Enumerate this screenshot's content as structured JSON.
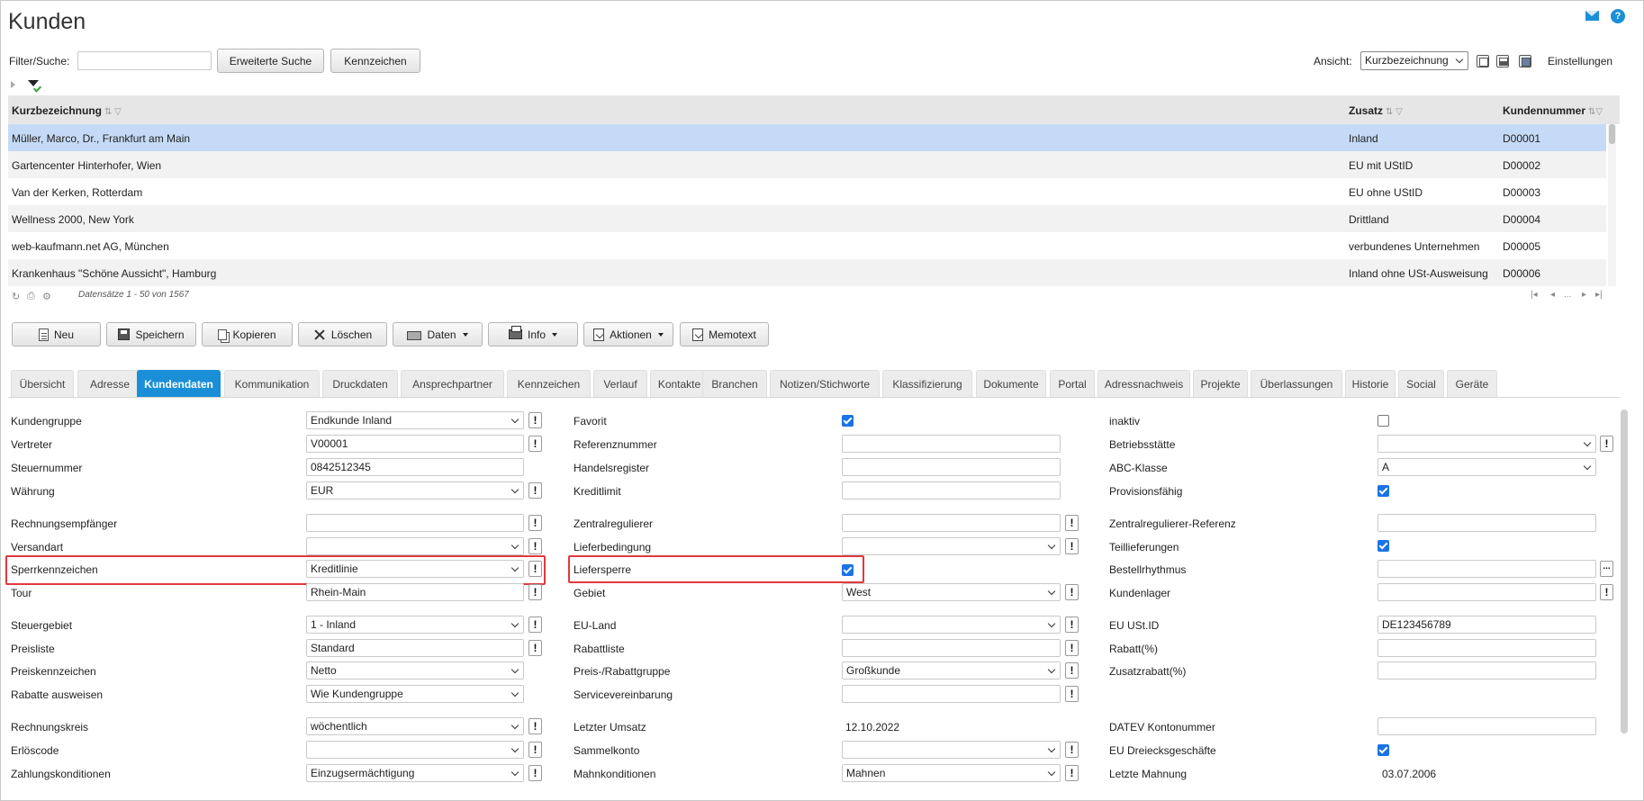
{
  "page": {
    "title": "Kunden"
  },
  "toolbar": {
    "filter_label": "Filter/Suche:",
    "filter_value": "",
    "extended_search": "Erweiterte Suche",
    "marks": "Kennzeichen",
    "view_label": "Ansicht:",
    "view_value": "Kurzbezeichnung",
    "settings": "Einstellungen"
  },
  "grid": {
    "columns": [
      "Kurzbezeichnung",
      "Zusatz",
      "Kundennummer"
    ],
    "rows": [
      [
        "Müller, Marco, Dr., Frankfurt am Main",
        "Inland",
        "D00001"
      ],
      [
        "Gartencenter Hinterhofer, Wien",
        "EU mit UStID",
        "D00002"
      ],
      [
        "Van der Kerken, Rotterdam",
        "EU ohne UStID",
        "D00003"
      ],
      [
        "Wellness 2000, New York",
        "Drittland",
        "D00004"
      ],
      [
        "web-kaufmann.net AG, München",
        "verbundenes Unternehmen",
        "D00005"
      ],
      [
        "Krankenhaus \"Schöne Aussicht\", Hamburg",
        "Inland ohne USt-Ausweisung",
        "D00006"
      ]
    ],
    "record_info": "Datensätze 1 - 50 von 1567",
    "pager_ellipsis": "..."
  },
  "actions": {
    "new": "Neu",
    "save": "Speichern",
    "copy": "Kopieren",
    "delete": "Löschen",
    "data": "Daten",
    "info": "Info",
    "actions": "Aktionen",
    "memo": "Memotext"
  },
  "tabs": [
    "Übersicht",
    "Adresse",
    "Kundendaten",
    "Kommunikation",
    "Druckdaten",
    "Ansprechpartner",
    "Kennzeichen",
    "Verlauf",
    "Kontakte",
    "Branchen",
    "Notizen/Stichworte",
    "Klassifizierung",
    "Dokumente",
    "Portal",
    "Adressnachweis",
    "Projekte",
    "Überlassungen",
    "Historie",
    "Social",
    "Geräte"
  ],
  "active_tab": "Kundendaten",
  "form": {
    "col1": {
      "kundengruppe": {
        "label": "Kundengruppe",
        "value": "Endkunde Inland"
      },
      "vertreter": {
        "label": "Vertreter",
        "value": "V00001"
      },
      "steuernummer": {
        "label": "Steuernummer",
        "value": "0842512345"
      },
      "waehrung": {
        "label": "Währung",
        "value": "EUR"
      },
      "rechnungsempfaenger": {
        "label": "Rechnungsempfänger",
        "value": ""
      },
      "versandart": {
        "label": "Versandart",
        "value": ""
      },
      "sperrkennzeichen": {
        "label": "Sperrkennzeichen",
        "value": "Kreditlinie"
      },
      "tour": {
        "label": "Tour",
        "value": "Rhein-Main"
      },
      "steuergebiet": {
        "label": "Steuergebiet",
        "value": "1 - Inland"
      },
      "preisliste": {
        "label": "Preisliste",
        "value": "Standard"
      },
      "preiskennzeichen": {
        "label": "Preiskennzeichen",
        "value": "Netto"
      },
      "rabatte": {
        "label": "Rabatte ausweisen",
        "value": "Wie Kundengruppe"
      },
      "rechnungskreis": {
        "label": "Rechnungskreis",
        "value": "wöchentlich"
      },
      "erloescode": {
        "label": "Erlöscode",
        "value": ""
      },
      "zahlungskonditionen": {
        "label": "Zahlungskonditionen",
        "value": "Einzugsermächtigung"
      }
    },
    "col2": {
      "favorit": {
        "label": "Favorit",
        "checked": true
      },
      "referenznummer": {
        "label": "Referenznummer",
        "value": ""
      },
      "handelsregister": {
        "label": "Handelsregister",
        "value": ""
      },
      "kreditlimit": {
        "label": "Kreditlimit",
        "value": ""
      },
      "zentralregulierer": {
        "label": "Zentralregulierer",
        "value": ""
      },
      "lieferbedingung": {
        "label": "Lieferbedingung",
        "value": ""
      },
      "liefersperre": {
        "label": "Liefersperre",
        "checked": true
      },
      "gebiet": {
        "label": "Gebiet",
        "value": "West"
      },
      "eu_land": {
        "label": "EU-Land",
        "value": ""
      },
      "rabattliste": {
        "label": "Rabattliste",
        "value": ""
      },
      "preis_rabattgruppe": {
        "label": "Preis-/Rabattgruppe",
        "value": "Großkunde"
      },
      "servicevereinbarung": {
        "label": "Servicevereinbarung",
        "value": ""
      },
      "letzter_umsatz": {
        "label": "Letzter Umsatz",
        "value": "12.10.2022"
      },
      "sammelkonto": {
        "label": "Sammelkonto",
        "value": ""
      },
      "mahnkonditionen": {
        "label": "Mahnkonditionen",
        "value": "Mahnen"
      }
    },
    "col3": {
      "inaktiv": {
        "label": "inaktiv",
        "checked": false
      },
      "betriebsstaette": {
        "label": "Betriebsstätte",
        "value": ""
      },
      "abc_klasse": {
        "label": "ABC-Klasse",
        "value": "A"
      },
      "provisionsfaehig": {
        "label": "Provisionsfähig",
        "checked": true
      },
      "zentralregulierer_ref": {
        "label": "Zentralregulierer-Referenz",
        "value": ""
      },
      "teillieferungen": {
        "label": "Teillieferungen",
        "checked": true
      },
      "bestellrhythmus": {
        "label": "Bestellrhythmus",
        "value": ""
      },
      "kundenlager": {
        "label": "Kundenlager",
        "value": ""
      },
      "eu_ustid": {
        "label": "EU USt.ID",
        "value": "DE123456789"
      },
      "rabatt": {
        "label": "Rabatt(%)",
        "value": ""
      },
      "zusatzrabatt": {
        "label": "Zusatzrabatt(%)",
        "value": ""
      },
      "datev": {
        "label": "DATEV Kontonummer",
        "value": ""
      },
      "eu_dreieck": {
        "label": "EU Dreiecksgeschäfte",
        "checked": true
      },
      "letzte_mahnung": {
        "label": "Letzte Mahnung",
        "value": "03.07.2006"
      }
    }
  },
  "icons": [
    "mail-icon",
    "help-icon",
    "filter-icon",
    "refresh-icon",
    "print-icon",
    "settings-icon"
  ],
  "colors": {
    "accent": "#1a8fd8",
    "selected_row": "#c5daf6",
    "highlight_box": "#e0393e",
    "checkbox": "#1a73e8"
  }
}
